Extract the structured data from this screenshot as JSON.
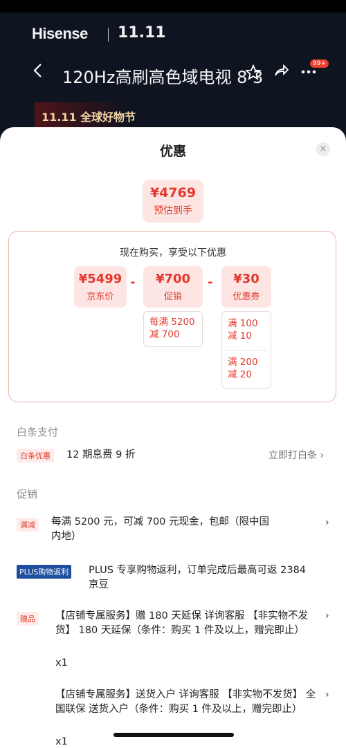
{
  "background": {
    "brand": "Hisense",
    "brand_event": "11.11",
    "back_icon": "chevron-left-icon",
    "title": "120Hz高刷高色域电视 8 3",
    "star_icon": "star-icon",
    "share_icon": "share-icon",
    "more_icon": "more-icon",
    "badge": "99+",
    "event_label": "11.11 全球好物节"
  },
  "sheet": {
    "title": "优惠",
    "close_icon": "×",
    "final": {
      "price": "¥4769",
      "label": "预估到手"
    },
    "frame_title": "现在购买，享受以下优惠",
    "boxes": [
      {
        "price": "¥5499",
        "label": "京东价"
      },
      {
        "price": "¥700",
        "label": "促销"
      },
      {
        "price": "¥30",
        "label": "优惠券"
      }
    ],
    "minus": "-",
    "promo_detail": [
      "每满 5200",
      "减 700"
    ],
    "coupon_details": [
      [
        "满 100",
        "减 10"
      ],
      [
        "满 200",
        "减 20"
      ]
    ],
    "baitiao": {
      "section": "白条支付",
      "tag": "白条优惠",
      "text": "12 期息费 9 折",
      "link": "立即打白条 ›"
    },
    "promotions": {
      "section": "促销",
      "items": [
        {
          "tag": "满减",
          "text": "每满 5200 元，可减 700 元现金，包邮（限中国内地）"
        },
        {
          "tag": "PLUS购物返利",
          "text": "PLUS 专享购物返利，订单完成后最高可返 2384 京豆"
        },
        {
          "tag": "赠品",
          "text": "【店铺专属服务】赠 180 天延保 详询客服 【非实物不发货】 180 天延保（条件：购买 1 件及以上，赠完即止）",
          "qty": "x1"
        },
        {
          "text": "【店铺专属服务】送货入户 详询客服 【非实物不发货】 全国联保 送货入户（条件：购买 1 件及以上，赠完即止）",
          "qty": "x1"
        }
      ]
    },
    "chevron": "›"
  }
}
